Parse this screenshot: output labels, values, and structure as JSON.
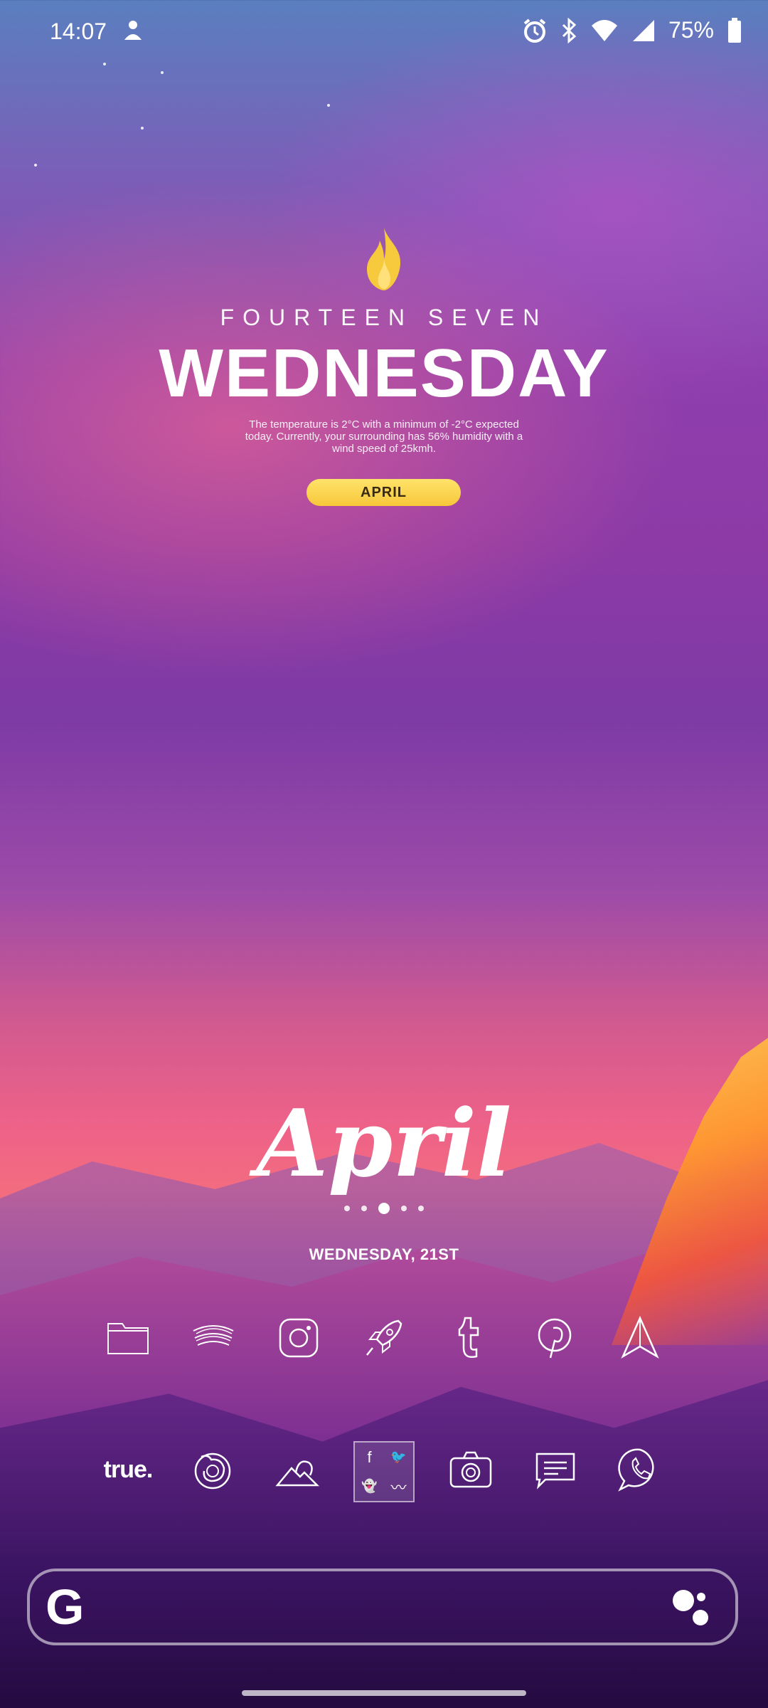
{
  "status_bar": {
    "time": "14:07",
    "battery": "75%",
    "icons": [
      "alarm-icon",
      "bluetooth-icon",
      "wifi-icon",
      "cellular-signal-icon",
      "battery-icon"
    ]
  },
  "weather_widget": {
    "subtitle": "FOURTEEN SEVEN",
    "day": "WEDNESDAY",
    "description": "The temperature is 2°C with a minimum of -2°C expected today. Currently, your surrounding has 56% humidity with a wind speed of 25kmh.",
    "month_pill": "APRIL",
    "accent_color": "#f9d44a"
  },
  "date_widget": {
    "month_script": "April",
    "date_line": "WEDNESDAY, 21ST",
    "page_count": 5,
    "active_page": 3
  },
  "apps_row1": [
    "files-icon",
    "spotify-icon",
    "instagram-icon",
    "rocket-icon",
    "tumblr-icon",
    "pinterest-icon",
    "send-icon"
  ],
  "apps_row2": {
    "true_label": "true.",
    "icons": [
      "firefox-icon",
      "gallery-icon",
      "social-folder",
      "camera-icon",
      "messages-icon",
      "whatsapp-icon"
    ],
    "folder_glyphs": [
      "f",
      "🐦",
      "👻",
      "〰"
    ]
  },
  "search": {
    "logo": "G"
  }
}
